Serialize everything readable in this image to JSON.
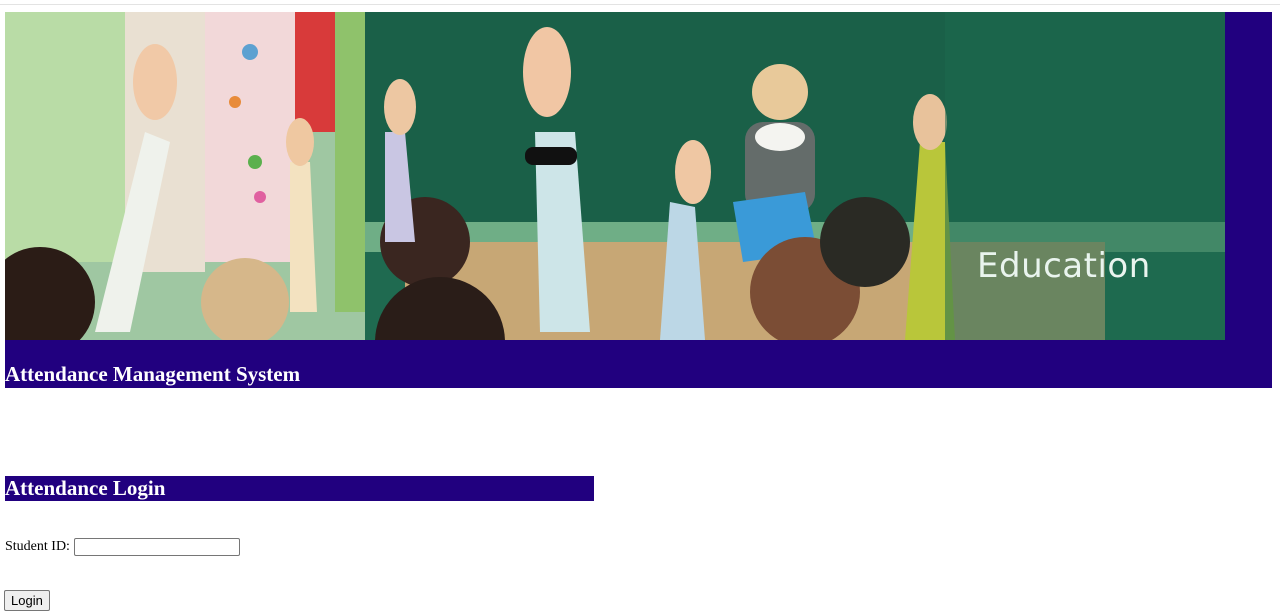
{
  "header": {
    "banner_caption": "Education",
    "title": "Attendance Management System"
  },
  "login": {
    "heading": "Attendance Login",
    "student_id_label": "Student ID:",
    "student_id_value": "",
    "button_label": "Login"
  },
  "colors": {
    "header_bg": "#21007f",
    "banner_board": "#1d6a4f",
    "text_on_header": "#ffffff"
  }
}
